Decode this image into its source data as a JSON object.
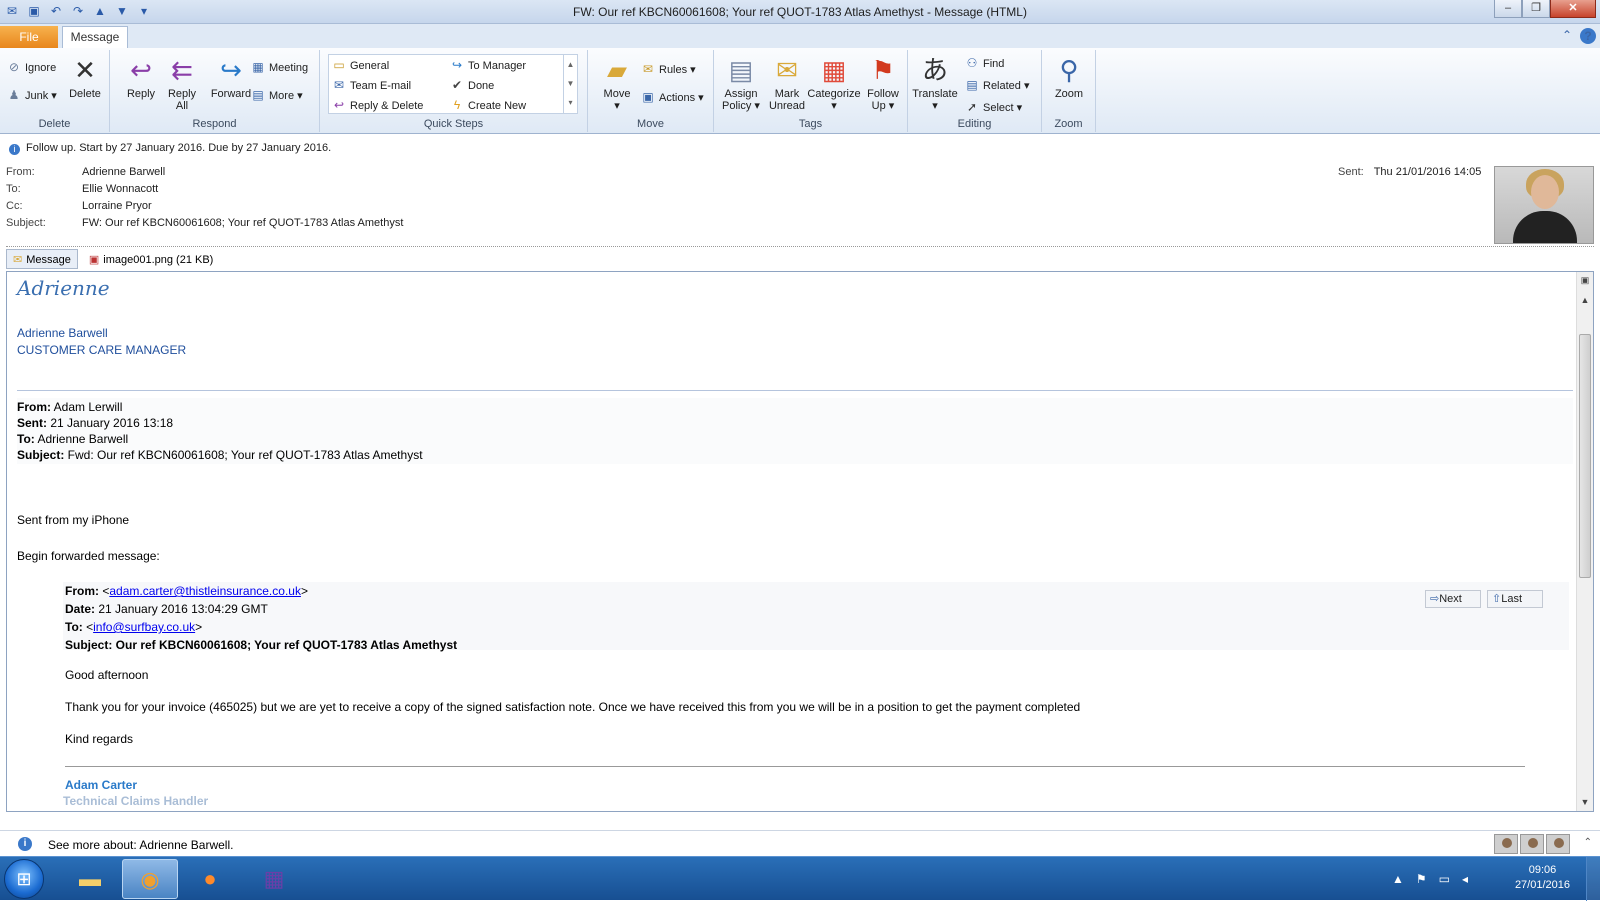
{
  "window": {
    "title": "FW: Our ref KBCN60061608; Your ref QUOT-1783 Atlas Amethyst  -  Message (HTML)"
  },
  "tabs": {
    "file": "File",
    "message": "Message"
  },
  "ribbon": {
    "delete_group": {
      "label": "Delete",
      "ignore": "Ignore",
      "junk": "Junk",
      "delete": "Delete"
    },
    "respond_group": {
      "label": "Respond",
      "reply": "Reply",
      "reply_all": "Reply All",
      "forward": "Forward",
      "meeting": "Meeting",
      "more": "More"
    },
    "quicksteps_group": {
      "label": "Quick Steps",
      "items": [
        "General",
        "To Manager",
        "Team E-mail",
        "Done",
        "Reply & Delete",
        "Create New"
      ]
    },
    "move_group": {
      "label": "Move",
      "move": "Move",
      "rules": "Rules",
      "actions": "Actions"
    },
    "tags_group": {
      "label": "Tags",
      "assign_policy": "Assign Policy",
      "mark_unread": "Mark Unread",
      "categorize": "Categorize",
      "follow_up": "Follow Up"
    },
    "editing_group": {
      "label": "Editing",
      "translate": "Translate",
      "find": "Find",
      "related": "Related",
      "select": "Select"
    },
    "zoom_group": {
      "label": "Zoom",
      "zoom": "Zoom"
    }
  },
  "header": {
    "info": "Follow up.  Start by 27 January 2016.  Due by 27 January 2016.",
    "from_label": "From:",
    "from": "Adrienne Barwell",
    "to_label": "To:",
    "to": "Ellie Wonnacott",
    "cc_label": "Cc:",
    "cc": "Lorraine Pryor",
    "subject_label": "Subject:",
    "subject": "FW: Our ref KBCN60061608; Your ref QUOT-1783 Atlas Amethyst",
    "sent_label": "Sent:",
    "sent": "Thu 21/01/2016 14:05"
  },
  "attachments": [
    {
      "label": "Message"
    },
    {
      "label": "image001.png (21 KB)"
    }
  ],
  "body": {
    "signature_script": "Adrienne",
    "sig_name": "Adrienne Barwell",
    "sig_title": "CUSTOMER CARE MANAGER",
    "fwd_from_label": "From:",
    "fwd_from": " Adam Lerwill",
    "fwd_sent_label": "Sent:",
    "fwd_sent": " 21 January 2016 13:18",
    "fwd_to_label": "To:",
    "fwd_to": " Adrienne Barwell",
    "fwd_subject_label": "Subject:",
    "fwd_subject": " Fwd: Our ref KBCN60061608; Your ref QUOT-1783 Atlas Amethyst",
    "iphone": "Sent from my iPhone",
    "begin_fwd": "Begin forwarded message:",
    "q_from_label": "From:",
    "q_from_email": "adam.carter@thistleinsurance.co.uk",
    "q_date_label": "Date:",
    "q_date": " 21 January 2016 13:04:29 GMT",
    "q_to_label": "To:",
    "q_to_email": "info@surfbay.co.uk",
    "q_subject": "Subject: Our ref KBCN60061608; Your ref QUOT-1783 Atlas Amethyst",
    "greeting": "Good afternoon",
    "message": "Thank you for your invoice (465025) but we are yet to receive a copy of the signed satisfaction note. Once we have received this from you we will be in a position to get the payment completed",
    "closing": "Kind regards",
    "sender_name": "Adam Carter",
    "sender_title": "Technical Claims Handler",
    "next": "Next",
    "last": "Last"
  },
  "people_bar": {
    "text": "See more about: Adrienne Barwell."
  },
  "taskbar": {
    "time": "09:06",
    "date": "27/01/2016"
  }
}
